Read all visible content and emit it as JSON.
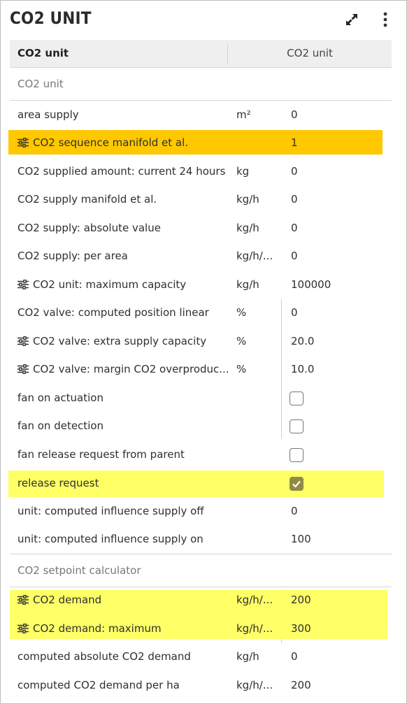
{
  "title": "CO2 UNIT",
  "header": {
    "col1": "CO2 unit",
    "col2": "CO2 unit"
  },
  "icons": {
    "expand": "expand-icon",
    "menu": "more-vert-icon",
    "settings": "sliders-icon"
  },
  "colors": {
    "highlight_orange": "#ffc800",
    "highlight_yellow": "#ffff66",
    "checkbox_checked": "#8f8b45"
  },
  "sections": {
    "co2_unit": "CO2 unit",
    "setpoint": "CO2 setpoint calculator"
  },
  "rows": [
    {
      "label": "area supply",
      "unit": "m²",
      "value": "0"
    },
    {
      "label": "CO2 sequence manifold et al.",
      "unit": "",
      "value": "1"
    },
    {
      "label": "CO2 supplied amount: current 24 hours",
      "unit": "kg",
      "value": "0"
    },
    {
      "label": "CO2 supply manifold et al.",
      "unit": "kg/h",
      "value": "0"
    },
    {
      "label": "CO2 supply: absolute value",
      "unit": "kg/h",
      "value": "0"
    },
    {
      "label": "CO2 supply: per area",
      "unit": "kg/h/...",
      "value": "0"
    },
    {
      "label": "CO2 unit: maximum capacity",
      "unit": "kg/h",
      "value": "100000"
    },
    {
      "label": "CO2 valve: computed position linear",
      "unit": "%",
      "value": "0"
    },
    {
      "label": "CO2 valve: extra supply capacity",
      "unit": "%",
      "value": "20.0"
    },
    {
      "label": "CO2 valve: margin CO2 overproduc...",
      "unit": "%",
      "value": "10.0"
    },
    {
      "label": "fan on actuation",
      "unit": "",
      "value": ""
    },
    {
      "label": "fan on detection",
      "unit": "",
      "value": ""
    },
    {
      "label": "fan release request from parent",
      "unit": "",
      "value": ""
    },
    {
      "label": "release request",
      "unit": "",
      "value": ""
    },
    {
      "label": "unit: computed influence supply off",
      "unit": "",
      "value": "0"
    },
    {
      "label": "unit: computed influence supply on",
      "unit": "",
      "value": "100"
    }
  ],
  "rows2": [
    {
      "label": "CO2 demand",
      "unit": "kg/h/...",
      "value": "200"
    },
    {
      "label": "CO2 demand: maximum",
      "unit": "kg/h/...",
      "value": "300"
    },
    {
      "label": "computed absolute CO2 demand",
      "unit": "kg/h",
      "value": "0"
    },
    {
      "label": "computed CO2 demand per ha",
      "unit": "kg/h/...",
      "value": "200"
    }
  ],
  "checkboxes": {
    "fan_on_actuation": false,
    "fan_on_detection": false,
    "fan_release_request": false,
    "release_request": true
  }
}
